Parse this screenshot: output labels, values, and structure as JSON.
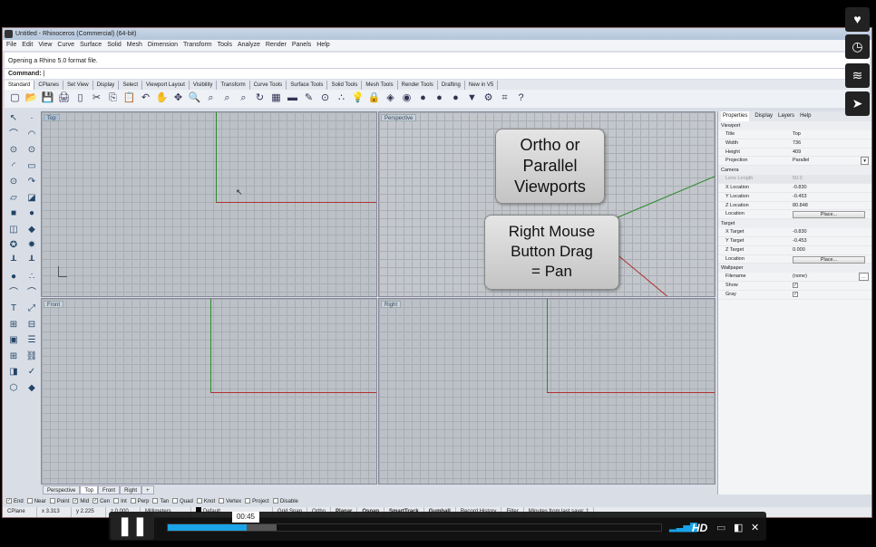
{
  "window": {
    "title": "Untitled - Rhinoceros (Commercial) (64-bit)"
  },
  "menu": [
    "File",
    "Edit",
    "View",
    "Curve",
    "Surface",
    "Solid",
    "Mesh",
    "Dimension",
    "Transform",
    "Tools",
    "Analyze",
    "Render",
    "Panels",
    "Help"
  ],
  "command": {
    "history": "Opening a Rhino 5.0 format file.",
    "prompt": "Command:",
    "value": ""
  },
  "toolbar_tabs": [
    "Standard",
    "CPlanes",
    "Set View",
    "Display",
    "Select",
    "Viewport Layout",
    "Visibility",
    "Transform",
    "Curve Tools",
    "Surface Tools",
    "Solid Tools",
    "Mesh Tools",
    "Render Tools",
    "Drafting",
    "New in V5"
  ],
  "toolbar_icons": [
    "new-icon",
    "open-icon",
    "save-icon",
    "print-icon",
    "template-icon",
    "cut-icon",
    "copy-icon",
    "paste-icon",
    "undo-icon",
    "pan-hand-icon",
    "move-icon",
    "zoom-icon",
    "zoom-window-icon",
    "zoom-extents-icon",
    "zoom-selected-icon",
    "rotate-view-icon",
    "viewport-layout-icon",
    "cplane-icon",
    "properties-icon",
    "snap-icon",
    "points-icon",
    "light-icon",
    "lock-icon",
    "layer-icon",
    "color-wheel-icon",
    "shaded-icon",
    "rendered-icon",
    "render-sphere-icon",
    "filter-icon",
    "options-gear-icon",
    "grid-icon",
    "help-icon"
  ],
  "toolbar_glyphs": [
    "▢",
    "📂",
    "💾",
    "🖨",
    "▯",
    "✂",
    "⎘",
    "📋",
    "↶",
    "✋",
    "✥",
    "🔍",
    "⌕",
    "⌕",
    "⌕",
    "↻",
    "▦",
    "▬",
    "✎",
    "⊙",
    "∴",
    "💡",
    "🔒",
    "◈",
    "◉",
    "●",
    "●",
    "●",
    "▼",
    "⚙",
    "⌗",
    "?"
  ],
  "toolbox_glyphs": [
    "↖",
    "·",
    "⌒",
    "◠",
    "⊙",
    "⊙",
    "◜",
    "▭",
    "⊙",
    "↷",
    "▱",
    "◪",
    "■",
    "●",
    "◫",
    "◆",
    "✪",
    "✸",
    "┸",
    "┸",
    "●",
    "∴",
    "⌒",
    "⌒",
    "T",
    "⤢",
    "⊞",
    "⊟",
    "▣",
    "☰",
    "⊞",
    "⛓",
    "◨",
    "✓",
    "⬡",
    "◆"
  ],
  "viewports": {
    "top": "Top",
    "perspective": "Perspective",
    "front": "Front",
    "right": "Right"
  },
  "callouts": {
    "ortho": [
      "Ortho or",
      "Parallel",
      "Viewports"
    ],
    "pan": [
      "Right Mouse",
      "Button Drag",
      "= Pan"
    ]
  },
  "properties": {
    "tabs": [
      "Properties",
      "Display",
      "Layers",
      "Help"
    ],
    "sections": {
      "viewport": {
        "label": "Viewport",
        "title": [
          "Title",
          "Top"
        ],
        "width": [
          "Width",
          "736"
        ],
        "height": [
          "Height",
          "409"
        ],
        "projection": [
          "Projection",
          "Parallel"
        ]
      },
      "camera": {
        "label": "Camera",
        "lens": [
          "Lens Length",
          "50.0"
        ],
        "x": [
          "X Location",
          "-0.830"
        ],
        "y": [
          "Y Location",
          "-0.453"
        ],
        "z": [
          "Z Location",
          "80.848"
        ],
        "loc": "Location",
        "place": "Place..."
      },
      "target": {
        "label": "Target",
        "x": [
          "X Target",
          "-0.830"
        ],
        "y": [
          "Y Target",
          "-0.453"
        ],
        "z": [
          "Z Target",
          "0.000"
        ],
        "loc": "Location",
        "place": "Place..."
      },
      "wallpaper": {
        "label": "Wallpaper",
        "filename": [
          "Filename",
          "(none)"
        ],
        "show": "Show",
        "gray": "Gray",
        "show_checked": true,
        "gray_checked": true
      }
    }
  },
  "viewport_tabs": [
    "Perspective",
    "Top",
    "Front",
    "Right",
    "+"
  ],
  "osnap": [
    {
      "l": "End",
      "c": true
    },
    {
      "l": "Near",
      "c": false
    },
    {
      "l": "Point",
      "c": false
    },
    {
      "l": "Mid",
      "c": true
    },
    {
      "l": "Cen",
      "c": true
    },
    {
      "l": "Int",
      "c": false
    },
    {
      "l": "Perp",
      "c": false
    },
    {
      "l": "Tan",
      "c": false
    },
    {
      "l": "Quad",
      "c": false
    },
    {
      "l": "Knot",
      "c": false
    },
    {
      "l": "Vertex",
      "c": false
    },
    {
      "l": "Project",
      "c": false
    },
    {
      "l": "Disable",
      "c": false
    }
  ],
  "status": {
    "cplane": "CPlane",
    "x": "x 3.313",
    "y": "y 2.225",
    "z": "z 0.000",
    "units": "Millimeters",
    "layer": "Default",
    "toggles": [
      "Grid Snap",
      "Ortho",
      "Planar",
      "Osnap",
      "SmartTrack",
      "Gumball",
      "Record History",
      "Filter"
    ],
    "bold_toggles": [
      "Planar",
      "Osnap",
      "SmartTrack",
      "Gumball"
    ],
    "info": "Minutes from last save: 1"
  },
  "player": {
    "time": "00:45",
    "played_fraction": 0.16,
    "buffered_fraction": 0.22,
    "hd": "HD",
    "accent": "#1aa3e6",
    "side_icons": [
      "heart-icon",
      "clock-icon",
      "layers-icon",
      "send-icon"
    ]
  }
}
